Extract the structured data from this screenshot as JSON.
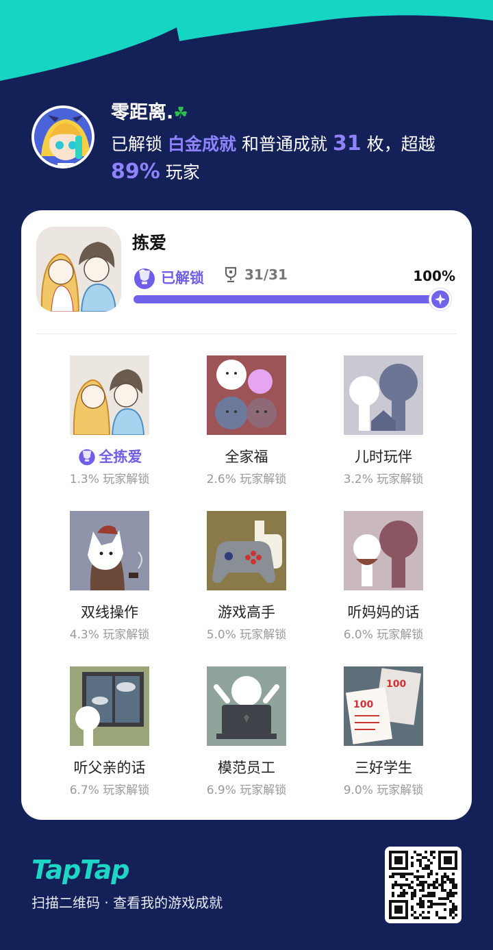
{
  "colors": {
    "background": "#142158",
    "accent": "#7162ec",
    "teal": "#1fd6c6",
    "card": "#ffffff"
  },
  "profile": {
    "username": "零距离.",
    "username_icon": "clover-icon",
    "stat_prefix": "已解锁",
    "stat_platinum": "白金成就",
    "stat_middle": "和普通成就",
    "stat_count": "31",
    "stat_suffix": "枚，超越",
    "stat_percent": "89%",
    "stat_end": "玩家"
  },
  "game": {
    "title": "拣爱",
    "unlocked_label": "已解锁",
    "trophy_count": "31/31",
    "progress_label": "100%",
    "progress_fraction": 1.0
  },
  "achievements": [
    {
      "name": "全拣爱",
      "rate": "1.3% 玩家解锁",
      "platinum": true
    },
    {
      "name": "全家福",
      "rate": "2.6% 玩家解锁",
      "platinum": false
    },
    {
      "name": "儿时玩伴",
      "rate": "3.2% 玩家解锁",
      "platinum": false
    },
    {
      "name": "双线操作",
      "rate": "4.3% 玩家解锁",
      "platinum": false
    },
    {
      "name": "游戏高手",
      "rate": "5.0% 玩家解锁",
      "platinum": false
    },
    {
      "name": "听妈妈的话",
      "rate": "6.0% 玩家解锁",
      "platinum": false
    },
    {
      "name": "听父亲的话",
      "rate": "6.7% 玩家解锁",
      "platinum": false
    },
    {
      "name": "模范员工",
      "rate": "6.9% 玩家解锁",
      "platinum": false
    },
    {
      "name": "三好学生",
      "rate": "9.0% 玩家解锁",
      "platinum": false
    }
  ],
  "footer": {
    "logo": "TapTap",
    "caption": "扫描二维码 · 查看我的游戏成就"
  }
}
